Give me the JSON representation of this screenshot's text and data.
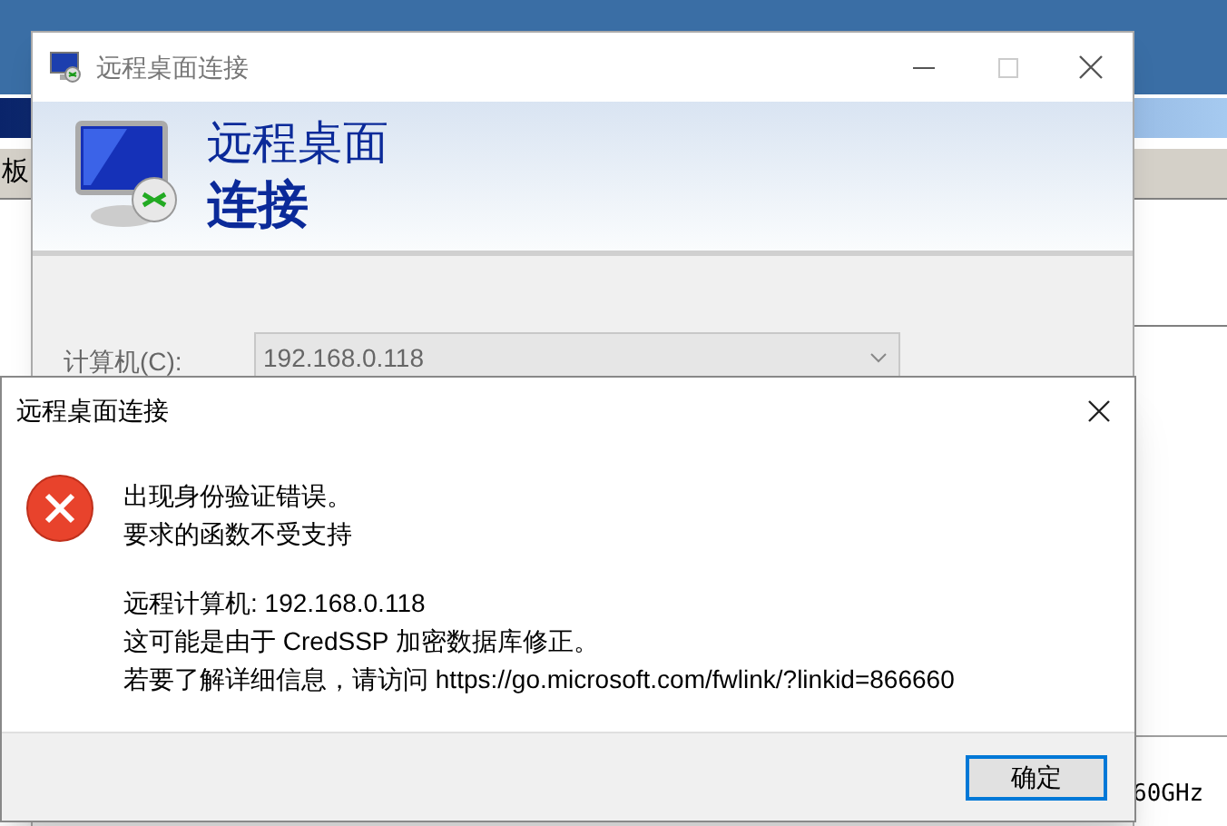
{
  "background": {
    "toolbar_text": "板",
    "cpu_text": "60GHz"
  },
  "main_window": {
    "title": "远程桌面连接",
    "banner_line_1": "远程桌面",
    "banner_line_2": "连接",
    "computer_label": "计算机(C):",
    "computer_value": "192.168.0.118"
  },
  "dialog": {
    "title": "远程桌面连接",
    "message_lines": [
      "出现身份验证错误。",
      "要求的函数不受支持"
    ],
    "detail_lines": [
      "远程计算机: 192.168.0.118",
      "这可能是由于 CredSSP 加密数据库修正。",
      "若要了解详细信息，请访问 https://go.microsoft.com/fwlink/?linkid=866660"
    ],
    "buttons": [
      {
        "label": "确定",
        "selected": true
      }
    ]
  }
}
